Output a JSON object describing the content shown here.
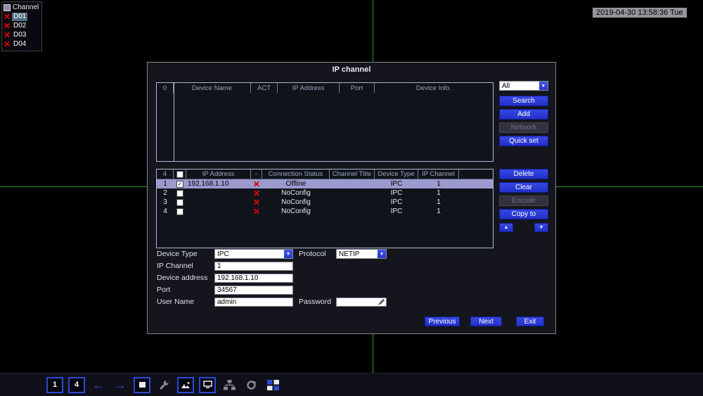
{
  "icons": {
    "check": "✓",
    "up": "▲",
    "down": "▼",
    "dd_arrow": "▼",
    "left": "←",
    "right": "→"
  },
  "osd": {
    "channel_panel": {
      "title": "Channel",
      "items": [
        {
          "label": "D01"
        },
        {
          "label": "D02"
        },
        {
          "label": "D03"
        },
        {
          "label": "D04"
        }
      ]
    },
    "timestamp": "2019-04-30 13:58:36 Tue"
  },
  "dialog": {
    "title": "IP channel",
    "search_table": {
      "headers": [
        "0",
        "Device Name",
        "ACT",
        "IP Address",
        "Port",
        "Device Info."
      ]
    },
    "filter_value": "All",
    "buttons": {
      "search": "Search",
      "add": "Add",
      "network": "Network",
      "quick_set": "Quick set",
      "delete": "Delete",
      "clear": "Clear",
      "encode": "Encode",
      "copy_to": "Copy to",
      "previous": "Previous",
      "next": "Next",
      "exit": "Exit"
    },
    "device_table": {
      "count_header": "4",
      "headers": [
        "IP Address",
        "-",
        "Connection Status",
        "Channel Title",
        "Device Type",
        "IP Channel"
      ],
      "rows": [
        {
          "no": "1",
          "ip": "192.168.1.10",
          "status": "Offline",
          "channel_title": "",
          "device_type": "IPC",
          "ip_channel": "1"
        },
        {
          "no": "2",
          "ip": "",
          "status": "NoConfig",
          "channel_title": "",
          "device_type": "IPC",
          "ip_channel": "1"
        },
        {
          "no": "3",
          "ip": "",
          "status": "NoConfig",
          "channel_title": "",
          "device_type": "IPC",
          "ip_channel": "1"
        },
        {
          "no": "4",
          "ip": "",
          "status": "NoConfig",
          "channel_title": "",
          "device_type": "IPC",
          "ip_channel": "1"
        }
      ]
    },
    "form": {
      "device_type_label": "Device Type",
      "device_type_value": "IPC",
      "protocol_label": "Protocol",
      "protocol_value": "NETIP",
      "ip_channel_label": "IP Channel",
      "ip_channel_value": "1",
      "device_address_label": "Device address",
      "device_address_value": "192.168.1.10",
      "port_label": "Port",
      "port_value": "34567",
      "user_name_label": "User Name",
      "user_name_value": "admin",
      "password_label": "Password",
      "password_value": ""
    }
  },
  "toolbar": {
    "single_label": "1",
    "quad_label": "4"
  }
}
